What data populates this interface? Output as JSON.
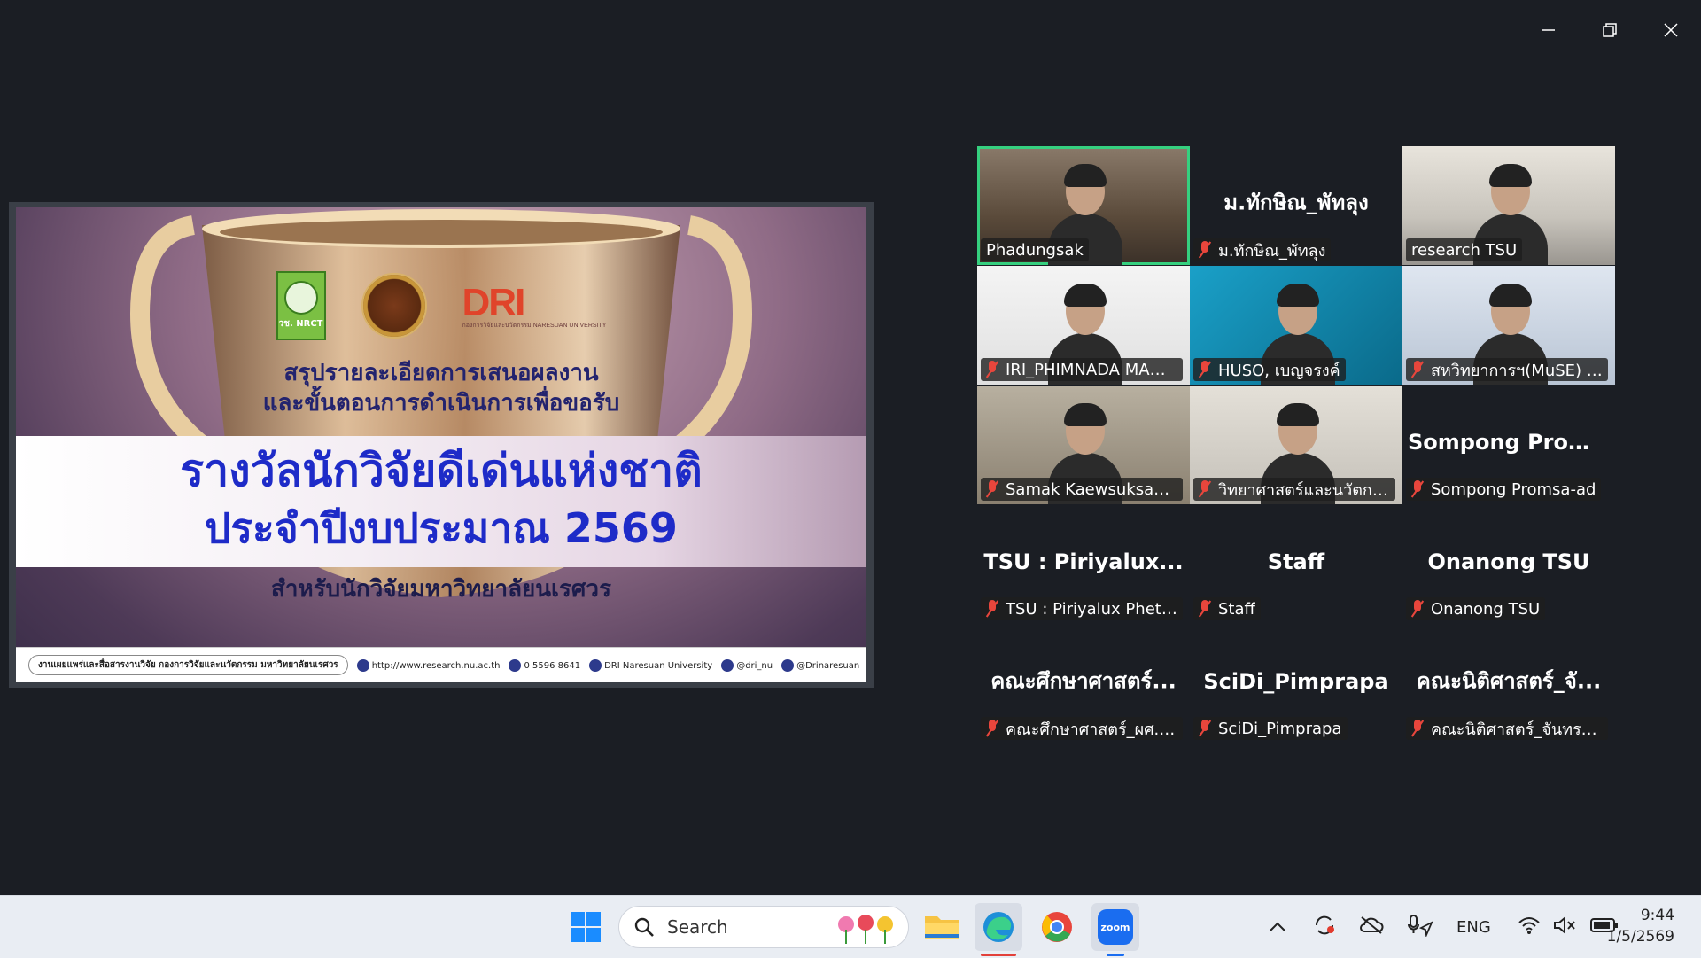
{
  "window_controls": [
    "minimize",
    "restore",
    "close"
  ],
  "slide": {
    "logos": {
      "nrct": "วช. NRCT",
      "dri": "DRI",
      "dri_sub": "กองการวิจัยและนวัตกรรม NARESUAN UNIVERSITY"
    },
    "subtitle_line1": "สรุปรายละเอียดการเสนอผลงาน",
    "subtitle_line2": "และขั้นตอนการดำเนินการเพื่อขอรับ",
    "title_line1": "รางวัลนักวิจัยดีเด่นแห่งชาติ",
    "title_line2": "ประจำปีงบประมาณ 2569",
    "subtitle_line3": "สำหรับนักวิจัยมหาวิทยาลัยนเรศวร",
    "footer": {
      "main": "งานเผยแพร่และสื่อสารงานวิจัย กองการวิจัยและนวัตกรรม มหาวิทยาลัยนเรศวร",
      "website": "http://www.research.nu.ac.th",
      "phone": "0 5596 8641",
      "facebook": "DRI Naresuan University",
      "line": "@dri_nu",
      "x": "@Drinaresuan"
    }
  },
  "participants": [
    {
      "label": "Phadungsak",
      "big": "",
      "video": true,
      "speaking": true,
      "muted": false
    },
    {
      "label": "ม.ทักษิณ_พัทลุง",
      "big": "ม.ทักษิณ_พัทลุง",
      "video": false,
      "speaking": false,
      "muted": true
    },
    {
      "label": "research TSU",
      "big": "",
      "video": true,
      "speaking": false,
      "muted": false
    },
    {
      "label": "IRI_PHIMNADA MANE...",
      "big": "",
      "video": true,
      "speaking": false,
      "muted": true
    },
    {
      "label": "HUSO, เบญจรงค์",
      "big": "",
      "video": true,
      "speaking": false,
      "muted": true
    },
    {
      "label": "สหวิทยาการฯ(MuSE) ธน...",
      "big": "",
      "video": true,
      "speaking": false,
      "muted": true
    },
    {
      "label": "Samak Kaewsuksaeng,...",
      "big": "",
      "video": true,
      "speaking": false,
      "muted": true
    },
    {
      "label": "วิทยาศาสตร์และนวัตกรรม...",
      "big": "",
      "video": true,
      "speaking": false,
      "muted": true
    },
    {
      "label": "Sompong Promsa-ad",
      "big": "Sompong  Prom...",
      "video": false,
      "speaking": false,
      "muted": true
    },
    {
      "label": "TSU : Piriyalux Phethu...",
      "big": "TSU : Piriyalux...",
      "video": false,
      "speaking": false,
      "muted": true
    },
    {
      "label": "Staff",
      "big": "Staff",
      "video": false,
      "speaking": false,
      "muted": true
    },
    {
      "label": "Onanong TSU",
      "big": "Onanong TSU",
      "video": false,
      "speaking": false,
      "muted": true
    },
    {
      "label": "คณะศึกษาศาสตร์_ผศ.ดร....",
      "big": "คณะศึกษาศาสตร์...",
      "video": false,
      "speaking": false,
      "muted": true
    },
    {
      "label": "SciDi_Pimprapa",
      "big": "SciDi_Pimprapa",
      "video": false,
      "speaking": false,
      "muted": true
    },
    {
      "label": "คณะนิติศาสตร์_จันทราทิพ...",
      "big": "คณะนิติศาสตร์_จั...",
      "video": false,
      "speaking": false,
      "muted": true
    }
  ],
  "taskbar": {
    "search_placeholder": "Search",
    "apps": [
      "start-icon",
      "file-explorer-icon",
      "edge-icon",
      "chrome-icon",
      "zoom-icon"
    ],
    "zoom_label": "zoom",
    "language": "ENG",
    "time": "9:44",
    "date": "1/5/2569"
  }
}
